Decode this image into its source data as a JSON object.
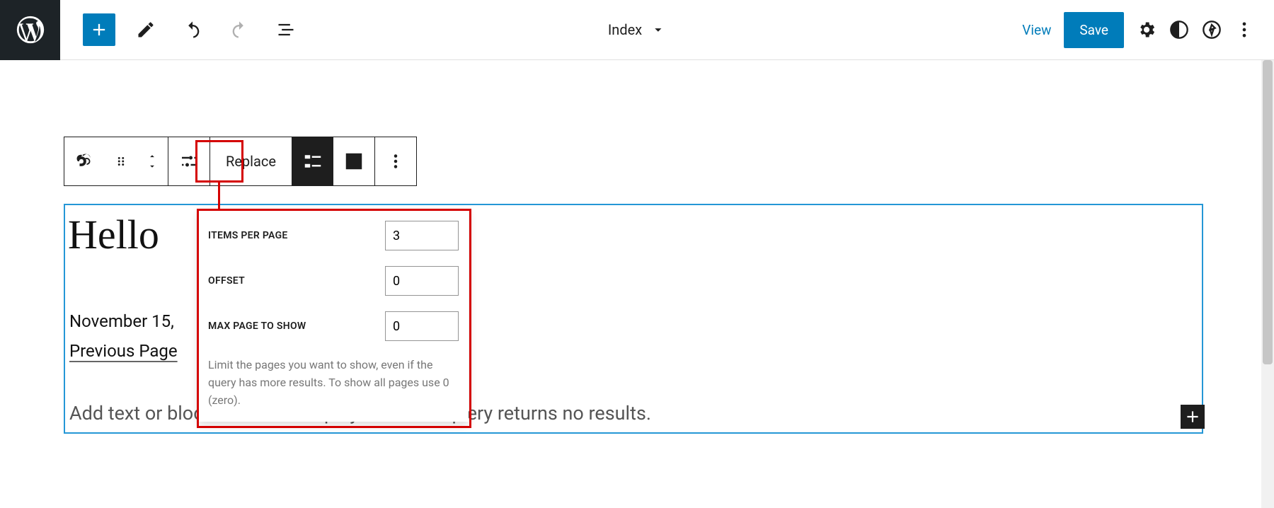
{
  "topbar": {
    "template_name": "Index",
    "view_label": "View",
    "save_label": "Save"
  },
  "block_toolbar": {
    "replace_label": "Replace"
  },
  "popover": {
    "items_per_page_label": "Items per page",
    "items_per_page_value": "3",
    "offset_label": "Offset",
    "offset_value": "0",
    "max_page_label": "Max page to show",
    "max_page_value": "0",
    "help_text": "Limit the pages you want to show, even if the query has more results. To show all pages use 0 (zero)."
  },
  "canvas": {
    "post_title": "Hello",
    "post_date": "November 15,",
    "pager_prev": "Previous Page",
    "no_results_placeholder": "Add text or blocks that will display when the query returns no results."
  }
}
